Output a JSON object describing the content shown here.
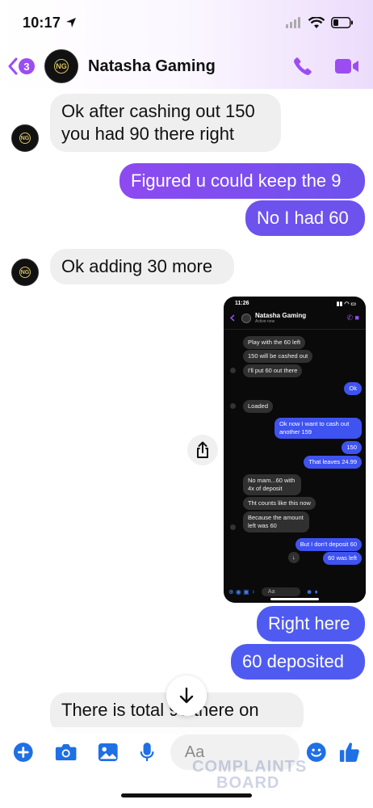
{
  "status_bar": {
    "time": "10:17"
  },
  "header": {
    "back_count": "3",
    "contact_name": "Natasha Gaming",
    "avatar_text": "NG"
  },
  "messages": [
    {
      "dir": "in",
      "text_line1": "Ok after cashing out 150",
      "text_line2": "you had 90 there right"
    },
    {
      "dir": "out",
      "text": "Figured u could keep the 9"
    },
    {
      "dir": "out",
      "text": "No I had 60"
    },
    {
      "dir": "in",
      "text": "Ok adding 30 more"
    },
    {
      "dir": "out",
      "text": "Right here"
    },
    {
      "dir": "out",
      "text": "60 deposited"
    },
    {
      "dir": "in",
      "text": "There is total 90 there on"
    }
  ],
  "screenshot": {
    "time": "11:26",
    "contact_name": "Natasha Gaming",
    "contact_status": "Active now",
    "input_placeholder": "Aa",
    "messages": [
      {
        "dir": "in",
        "text": "Play with the 60 left"
      },
      {
        "dir": "in",
        "text": "150 will be cashed out"
      },
      {
        "dir": "in",
        "text": "I'll put 60 out there"
      },
      {
        "dir": "out",
        "text": "Ok"
      },
      {
        "dir": "in",
        "text": "Loaded"
      },
      {
        "dir": "out",
        "text": "Ok now I want to cash out another 159"
      },
      {
        "dir": "out",
        "text": "150"
      },
      {
        "dir": "out",
        "text": "That leaves 24.99"
      },
      {
        "dir": "in",
        "text": "No mam...60 with 4x of deposit"
      },
      {
        "dir": "in",
        "text": "Tht counts like this now"
      },
      {
        "dir": "in",
        "text": "Because the amount left was 60"
      },
      {
        "dir": "out",
        "text": "But I don't deposit 60"
      },
      {
        "dir": "out",
        "text": "60 was left"
      }
    ]
  },
  "composer": {
    "placeholder": "Aa"
  },
  "watermark": {
    "line1": "COMPLAINTS",
    "line2": "BOARD"
  },
  "colors": {
    "accent": "#9b4df2",
    "outgoing_start": "#8d4af0",
    "outgoing_end": "#4f5bf0",
    "incoming": "#efefef",
    "icon_blue": "#1f6fe5"
  }
}
